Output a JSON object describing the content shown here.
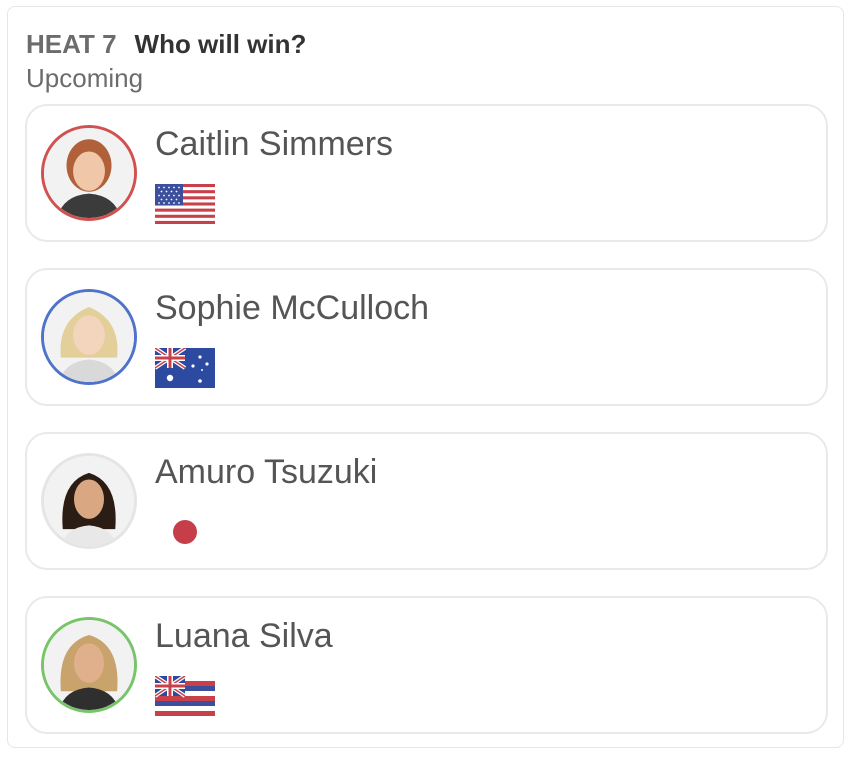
{
  "heat": {
    "label": "HEAT 7",
    "question": "Who will win?",
    "status": "Upcoming"
  },
  "surfers": [
    {
      "name": "Caitlin Simmers",
      "flag": "usa-flag-icon",
      "ring_color": "#d0514f",
      "hair_color": "#b0613a"
    },
    {
      "name": "Sophie McCulloch",
      "flag": "australia-flag-icon",
      "ring_color": "#4f73c9",
      "hair_color": "#e3cf9a"
    },
    {
      "name": "Amuro Tsuzuki",
      "flag": "japan-flag-icon",
      "ring_color": "#e5e5e5",
      "hair_color": "#2b1d14"
    },
    {
      "name": "Luana Silva",
      "flag": "hawaii-flag-icon",
      "ring_color": "#78c46a",
      "hair_color": "#c8a46c"
    }
  ],
  "colors": {
    "flag_red": "#c8404a",
    "flag_blue": "#3c4f9c",
    "japan_dot": "#c53e4a"
  }
}
